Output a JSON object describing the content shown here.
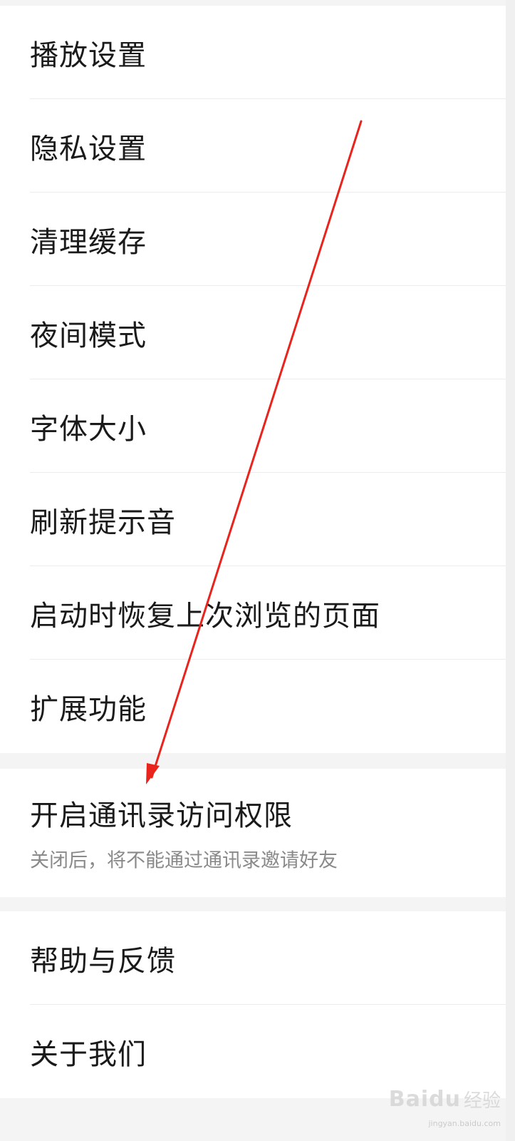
{
  "settings_group_1": {
    "items": [
      {
        "label": "播放设置"
      },
      {
        "label": "隐私设置"
      },
      {
        "label": "清理缓存"
      },
      {
        "label": "夜间模式"
      },
      {
        "label": "字体大小"
      },
      {
        "label": "刷新提示音"
      },
      {
        "label": "启动时恢复上次浏览的页面"
      },
      {
        "label": "扩展功能"
      }
    ]
  },
  "settings_group_2": {
    "contacts_permission": {
      "label": "开启通讯录访问权限",
      "description": "关闭后，将不能通过通讯录邀请好友"
    }
  },
  "settings_group_3": {
    "items": [
      {
        "label": "帮助与反馈"
      },
      {
        "label": "关于我们"
      }
    ]
  },
  "annotation": {
    "arrow_color": "#e8241c"
  },
  "watermark": {
    "logo": "Baidu",
    "product": "经验",
    "domain": "jingyan.baidu.com"
  }
}
